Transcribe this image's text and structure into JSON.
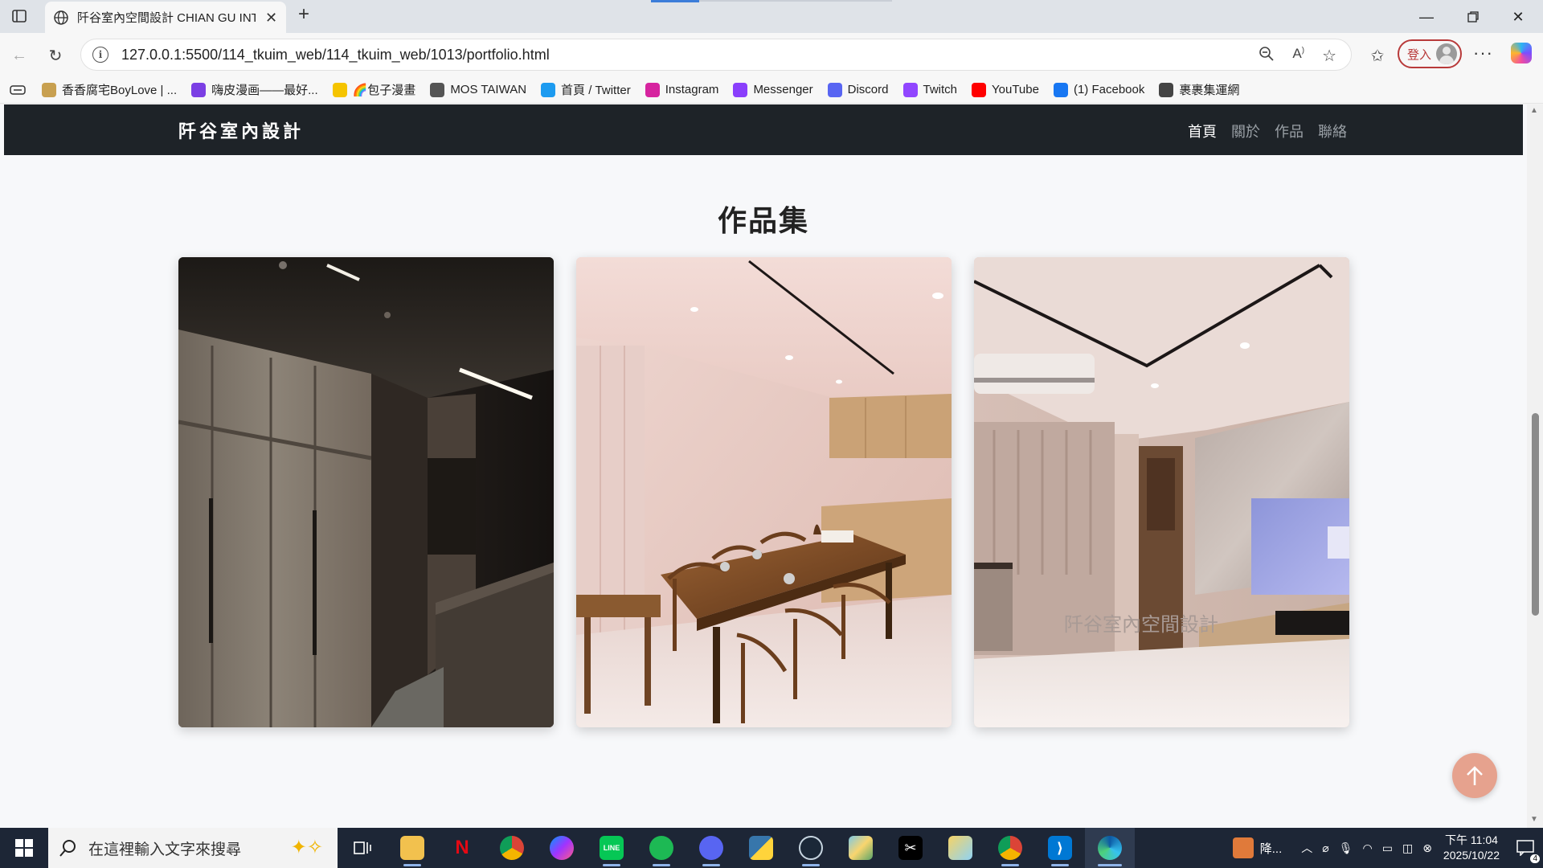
{
  "browser": {
    "tab_title": "阡谷室內空間設計 CHIAN GU INT",
    "url": "127.0.0.1:5500/114_tkuim_web/114_tkuim_web/1013/portfolio.html",
    "login_label": "登入",
    "bookmarks": [
      {
        "label": "香香腐宅BoyLove | ...",
        "icon": "boylove-icon",
        "color": "#c8a050"
      },
      {
        "label": "嗨皮漫画——最好...",
        "icon": "h-icon",
        "color": "#7b3fe4"
      },
      {
        "label": "🌈包子漫畫",
        "icon": "baozi-icon",
        "color": "#f5c400"
      },
      {
        "label": "MOS TAIWAN",
        "icon": "mos-icon",
        "color": "#555555"
      },
      {
        "label": "首頁 / Twitter",
        "icon": "twitter-icon",
        "color": "#1d9bf0"
      },
      {
        "label": "Instagram",
        "icon": "instagram-icon",
        "color": "#d6249f"
      },
      {
        "label": "Messenger",
        "icon": "messenger-icon",
        "color": "#8a3ffc"
      },
      {
        "label": "Discord",
        "icon": "discord-icon",
        "color": "#5865f2"
      },
      {
        "label": "Twitch",
        "icon": "twitch-icon",
        "color": "#9146ff"
      },
      {
        "label": "YouTube",
        "icon": "youtube-icon",
        "color": "#ff0000"
      },
      {
        "label": "(1) Facebook",
        "icon": "facebook-icon",
        "color": "#1877f2"
      },
      {
        "label": "裹裹集運網",
        "icon": "globe-icon",
        "color": "#444444"
      }
    ]
  },
  "site": {
    "brand": "阡谷室內設計",
    "nav": [
      {
        "label": "首頁",
        "active": true
      },
      {
        "label": "關於",
        "active": false
      },
      {
        "label": "作品",
        "active": false
      },
      {
        "label": "聯絡",
        "active": false
      }
    ],
    "page_title": "作品集",
    "gallery": [
      {
        "name": "portfolio-image-wardrobe",
        "desc": "dark hallway wardrobe"
      },
      {
        "name": "portfolio-image-dining",
        "desc": "dining room with wood table"
      },
      {
        "name": "portfolio-image-living",
        "desc": "living room with tv"
      }
    ],
    "watermark": "阡谷室內空間設計"
  },
  "taskbar": {
    "search_placeholder": "在這裡輸入文字來搜尋",
    "tray_label": "降...",
    "time": "下午 11:04",
    "date": "2025/10/22",
    "notification_count": "4"
  }
}
